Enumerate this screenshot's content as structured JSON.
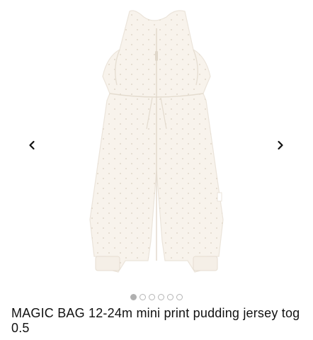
{
  "product": {
    "title": "MAGIC BAG 12-24m mini print pudding jersey tog 0.5",
    "brand_colors": {
      "garment": "#f8f3ec",
      "garment_shadow": "#ebe4da",
      "print_dots": "#d9cfc0"
    }
  },
  "carousel": {
    "prev_icon": "chevron-left-icon",
    "next_icon": "chevron-right-icon",
    "image_count": 6,
    "active_index": 0,
    "dots": [
      {
        "active": true
      },
      {
        "active": false
      },
      {
        "active": false
      },
      {
        "active": false
      },
      {
        "active": false
      },
      {
        "active": false
      }
    ]
  }
}
